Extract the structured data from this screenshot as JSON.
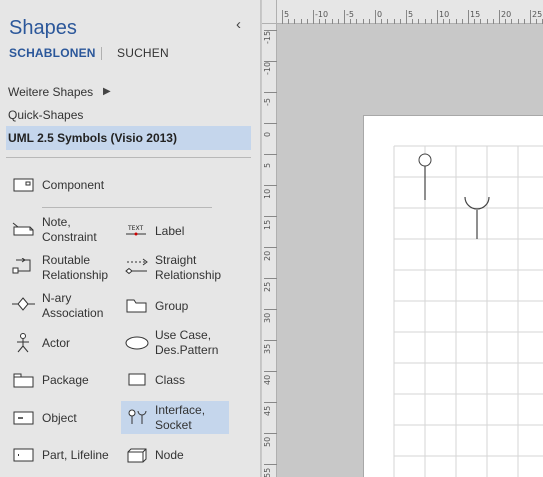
{
  "panel": {
    "title": "Shapes",
    "collapse_icon": "chevron-left-icon",
    "tabs": [
      {
        "label": "SCHABLONEN",
        "active": true
      },
      {
        "label": "SUCHEN",
        "active": false
      }
    ],
    "nav": {
      "more_shapes": "Weitere Shapes",
      "quick_shapes": "Quick-Shapes",
      "stencil": "UML 2.5 Symbols (Visio 2013)"
    },
    "shapes": {
      "component": "Component",
      "note": "Note,\nConstraint",
      "label": "Label",
      "routable": "Routable\nRelationship",
      "straight": "Straight\nRelationship",
      "nary": "N-ary\nAssociation",
      "group": "Group",
      "actor": "Actor",
      "usecase": "Use Case,\nDes.Pattern",
      "package": "Package",
      "class": "Class",
      "object": "Object",
      "interface": "Interface,\nSocket",
      "part": "Part, Lifeline",
      "node": "Node"
    },
    "label_icon_text": "TEXT"
  },
  "ruler": {
    "top_labels": [
      "5",
      "-10",
      "-5",
      "0",
      "5",
      "10",
      "15",
      "20",
      "25"
    ],
    "left_labels": [
      "-15",
      "-10",
      "-5",
      "0",
      "5",
      "10",
      "15",
      "20",
      "25",
      "30",
      "35",
      "40",
      "45",
      "50",
      "55"
    ]
  },
  "colors": {
    "accent": "#2b579a",
    "selection": "#c5d6ec",
    "panel_bg": "#e6e6e6",
    "canvas_bg": "#c8c8c8"
  }
}
